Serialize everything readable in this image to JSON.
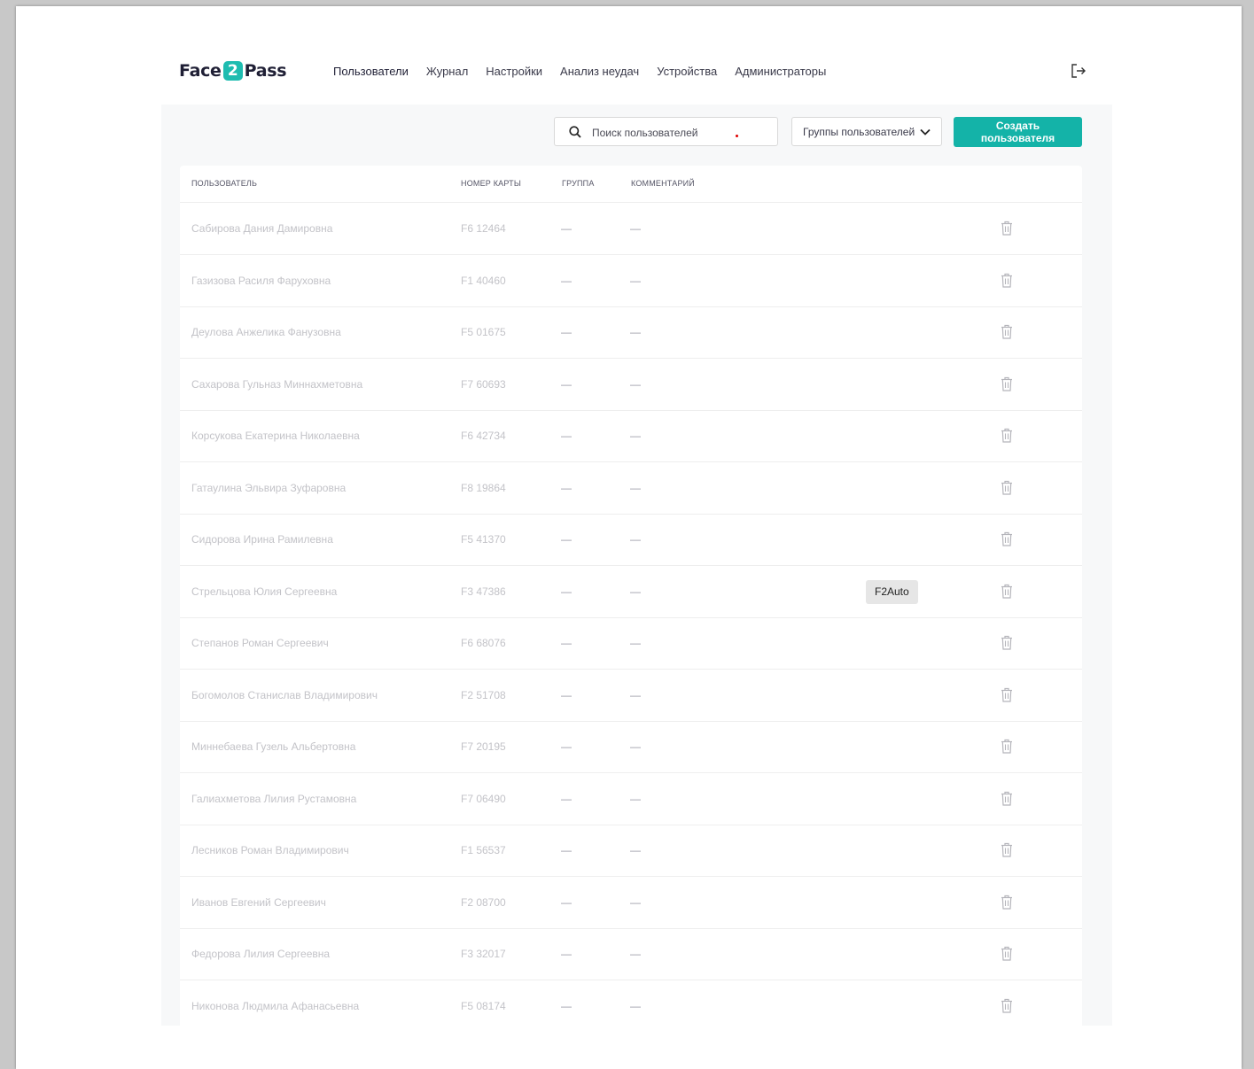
{
  "app": {
    "logo": {
      "left": "Face",
      "mid": "2",
      "right": "Pass"
    }
  },
  "nav": {
    "items": [
      "Пользователи",
      "Журнал",
      "Настройки",
      "Анализ неудач",
      "Устройства",
      "Администраторы"
    ],
    "active": "Пользователи"
  },
  "toolbar": {
    "search_placeholder": "Поиск пользователей",
    "groups_label": "Группы пользователей",
    "create_label": "Создать пользователя"
  },
  "table": {
    "headers": {
      "user": "ПОЛЬЗОВАТЕЛЬ",
      "card": "НОМЕР КАРТЫ",
      "group": "ГРУППА",
      "comment": "КОММЕНТАРИЙ"
    },
    "rows": [
      {
        "name": "Сабирова Дания Дамировна",
        "card": "F6 12464",
        "group": "—",
        "comment": "—",
        "tag": ""
      },
      {
        "name": "Газизова Расиля Фаруховна",
        "card": "F1 40460",
        "group": "—",
        "comment": "—",
        "tag": ""
      },
      {
        "name": "Деулова Анжелика Фанузовна",
        "card": "F5 01675",
        "group": "—",
        "comment": "—",
        "tag": ""
      },
      {
        "name": "Сахарова Гульназ Миннахметовна",
        "card": "F7 60693",
        "group": "—",
        "comment": "—",
        "tag": ""
      },
      {
        "name": "Корсукова Екатерина Николаевна",
        "card": "F6 42734",
        "group": "—",
        "comment": "—",
        "tag": ""
      },
      {
        "name": "Гатаулина Эльвира Зуфаровна",
        "card": "F8 19864",
        "group": "—",
        "comment": "—",
        "tag": ""
      },
      {
        "name": "Сидорова Ирина Рамилевна",
        "card": "F5 41370",
        "group": "—",
        "comment": "—",
        "tag": ""
      },
      {
        "name": "Стрельцова Юлия Сергеевна",
        "card": "F3 47386",
        "group": "—",
        "comment": "—",
        "tag": "F2Auto"
      },
      {
        "name": "Степанов Роман Сергеевич",
        "card": "F6 68076",
        "group": "—",
        "comment": "—",
        "tag": ""
      },
      {
        "name": "Богомолов Станислав Владимирович",
        "card": "F2 51708",
        "group": "—",
        "comment": "—",
        "tag": ""
      },
      {
        "name": "Миннебаева Гузель Альбертовна",
        "card": "F7 20195",
        "group": "—",
        "comment": "—",
        "tag": ""
      },
      {
        "name": "Галиахметова Лилия Рустамовна",
        "card": "F7 06490",
        "group": "—",
        "comment": "—",
        "tag": ""
      },
      {
        "name": "Лесников Роман Владимирович",
        "card": "F1 56537",
        "group": "—",
        "comment": "—",
        "tag": ""
      },
      {
        "name": "Иванов Евгений Сергеевич",
        "card": "F2 08700",
        "group": "—",
        "comment": "—",
        "tag": ""
      },
      {
        "name": "Федорова Лилия Сергеевна",
        "card": "F3 32017",
        "group": "—",
        "comment": "—",
        "tag": ""
      },
      {
        "name": "Никонова Людмила Афанасьевна",
        "card": "F5 08174",
        "group": "—",
        "comment": "—",
        "tag": ""
      }
    ]
  },
  "colors": {
    "accent": "#14b3a8",
    "logo_badge": "#1ebcb0"
  }
}
